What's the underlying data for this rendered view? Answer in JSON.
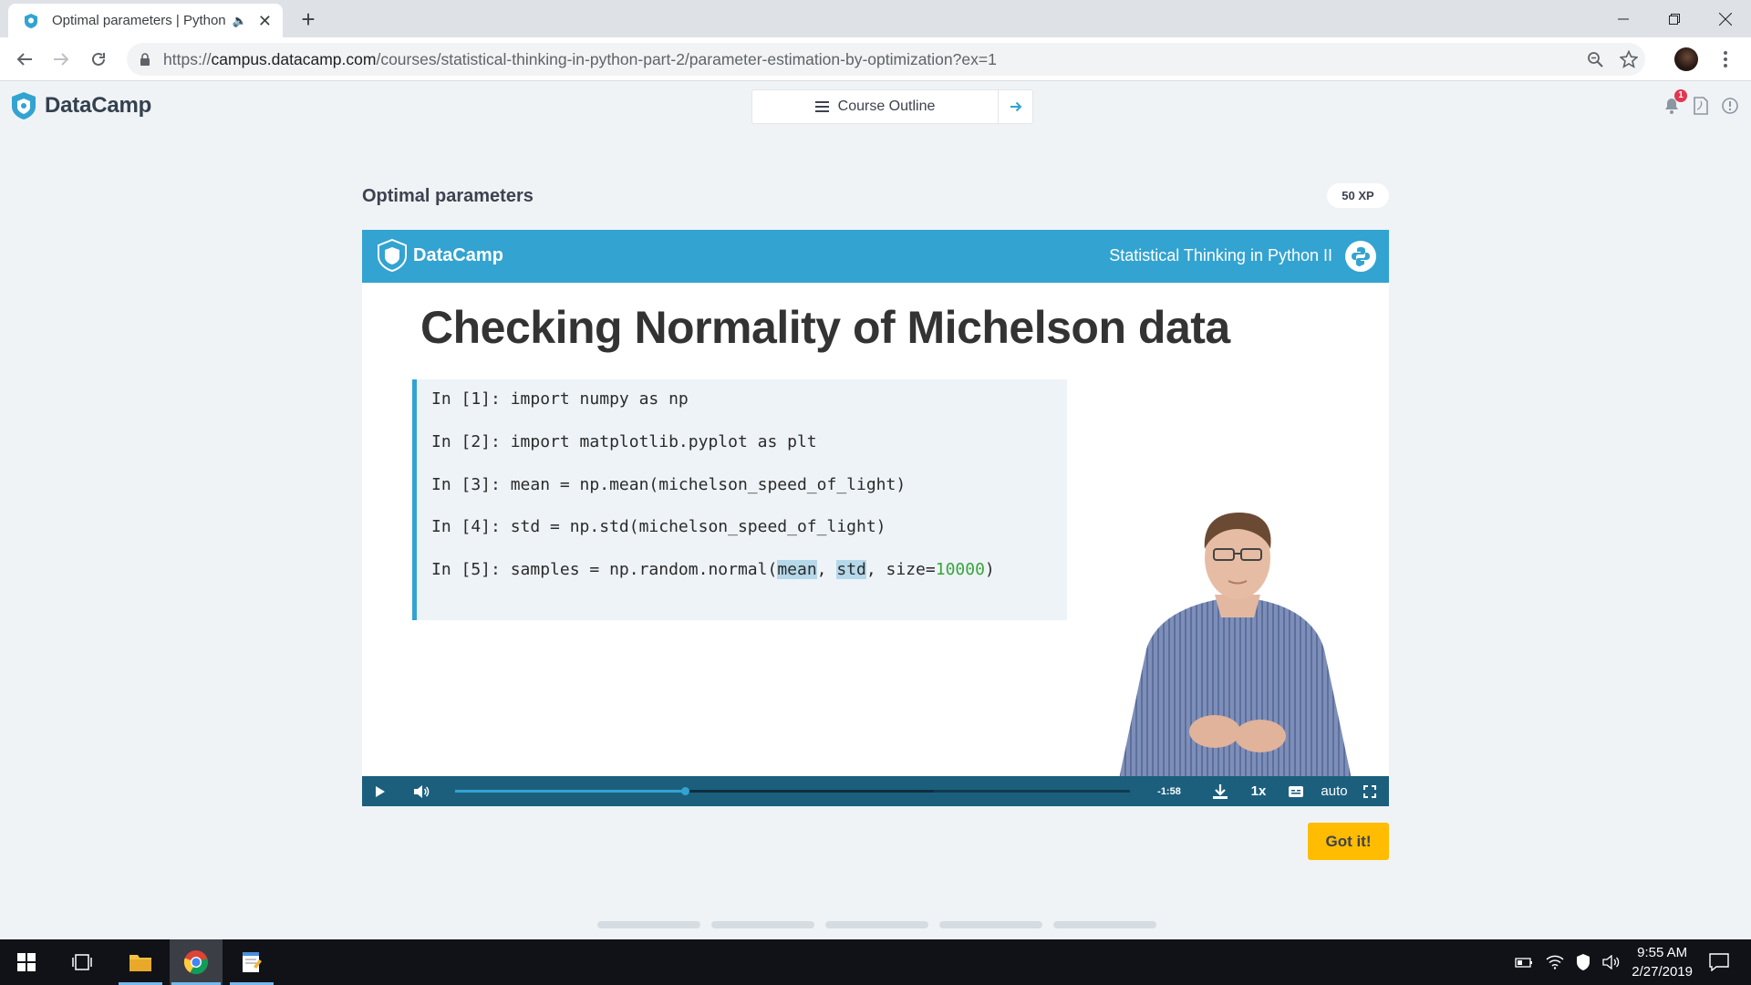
{
  "browser": {
    "tab_title": "Optimal parameters | Python",
    "new_tab": "+",
    "url_scheme": "https://",
    "url_host": "campus.datacamp.com",
    "url_path": "/courses/statistical-thinking-in-python-part-2/parameter-estimation-by-optimization?ex=1",
    "window_controls": [
      "minimize",
      "restore",
      "close"
    ]
  },
  "header": {
    "brand": "DataCamp",
    "course_outline": "Course Outline",
    "notification_count": "1"
  },
  "exercise": {
    "title": "Optimal parameters",
    "xp": "50 XP"
  },
  "video": {
    "slide_brand": "DataCamp",
    "course_name": "Statistical Thinking in Python II",
    "slide_title": "Checking Normality of Michelson data",
    "code": [
      {
        "prompt": "In [1]: ",
        "text": "import numpy as np"
      },
      {
        "prompt": "In [2]: ",
        "text": "import matplotlib.pyplot as plt"
      },
      {
        "prompt": "In [3]: ",
        "text": "mean = np.mean(michelson_speed_of_light)"
      },
      {
        "prompt": "In [4]: ",
        "text": "std = np.std(michelson_speed_of_light)"
      },
      {
        "prompt": "In [5]: ",
        "pre": "samples = np.random.normal(",
        "arg1": "mean",
        "sep1": ", ",
        "arg2": "std",
        "sep2": ", size=",
        "num": "10000",
        "post": ")"
      }
    ],
    "controls": {
      "time_remaining": "-1:58",
      "speed": "1x",
      "quality": "auto",
      "played_fraction": 0.34,
      "buffered_fraction": 0.71
    }
  },
  "actions": {
    "got_it": "Got it!",
    "pager_steps": 5
  },
  "taskbar": {
    "time": "9:55 AM",
    "date": "2/27/2019"
  },
  "colors": {
    "accent": "#33a3d1",
    "controls_bg": "#1c5f7d",
    "got_it": "#ffbc00"
  }
}
